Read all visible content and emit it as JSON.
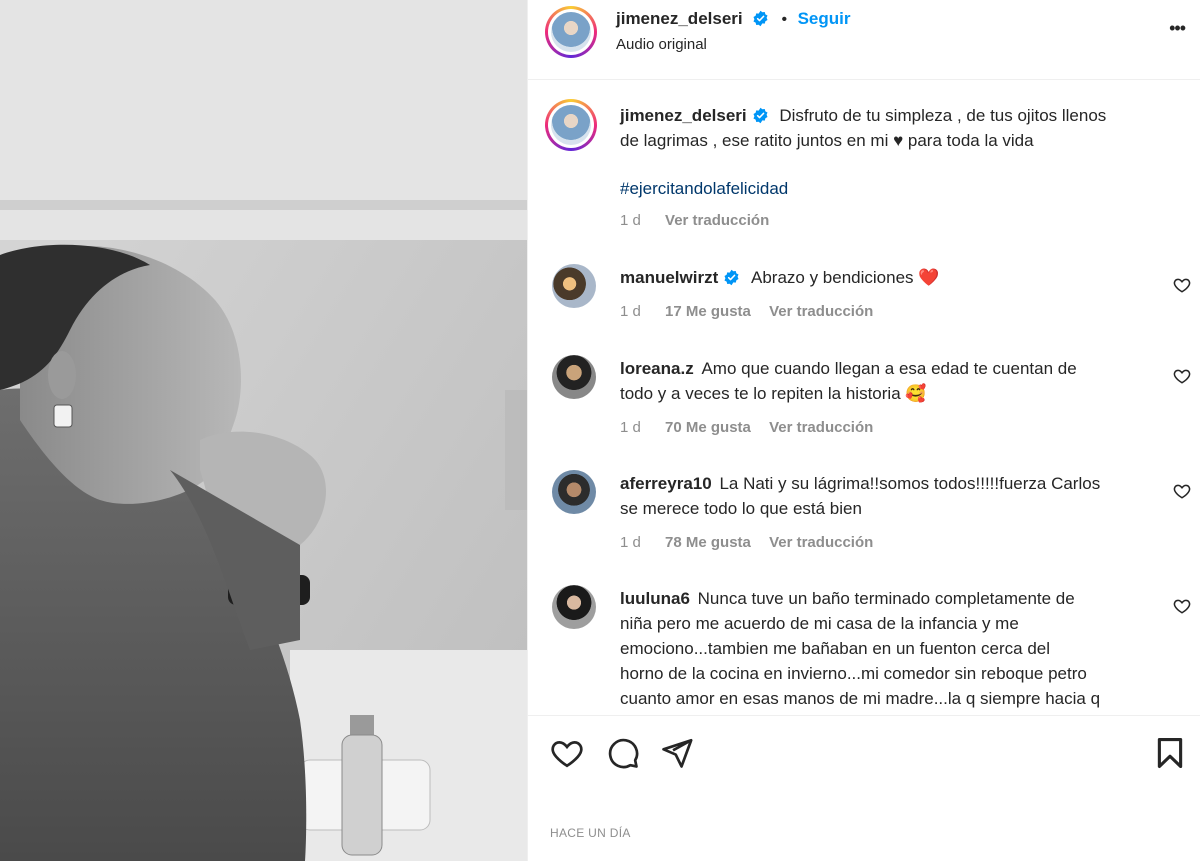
{
  "post": {
    "author": "jimenez_delseri",
    "audio": "Audio original",
    "follow_separator": "•",
    "follow_label": "Seguir",
    "more_label": "•••",
    "caption_line1": "Disfruto de tu simpleza , de tus ojitos llenos",
    "caption_line2": "de lagrimas , ese ratito juntos en mi ♥ para toda la vida",
    "hashtag": "#ejercitandolafelicidad",
    "caption_time": "1 d",
    "translate": "Ver traducción",
    "timestamp": "HACE UN DÍA"
  },
  "comments": [
    {
      "user": "manuelwirzt",
      "verified": true,
      "lines": [
        "Abrazo y bendiciones ❤️"
      ],
      "time": "1 d",
      "likes": "17 Me gusta",
      "translate": "Ver traducción"
    },
    {
      "user": "loreana.z",
      "verified": false,
      "lines": [
        "Amo que cuando llegan a esa edad te cuentan de",
        "todo y a veces te lo repiten la historia 🥰"
      ],
      "time": "1 d",
      "likes": "70 Me gusta",
      "translate": "Ver traducción"
    },
    {
      "user": "aferreyra10",
      "verified": false,
      "lines": [
        "La Nati y su lágrima!!somos todos!!!!!fuerza Carlos",
        "se merece todo lo que está bien"
      ],
      "time": "1 d",
      "likes": "78 Me gusta",
      "translate": "Ver traducción"
    },
    {
      "user": "luuluna6",
      "verified": false,
      "lines": [
        "Nunca tuve un baño terminado completamente de",
        "niña pero me acuerdo de mi casa de la infancia y me",
        "emociono...tambien me bañaban en un fuenton cerca del",
        "horno de la cocina en invierno...mi comedor sin reboque petro",
        "cuanto amor en esas manos de mi madre...la q siempre hacia q"
      ]
    }
  ],
  "icons": {
    "like": "heart-icon",
    "comment": "comment-icon",
    "share": "send-icon",
    "save": "bookmark-icon",
    "more": "more-icon",
    "verified": "verified-badge-icon"
  },
  "colors": {
    "link": "#0095f6",
    "hashtag": "#00376b",
    "secondary": "#8e8e8e",
    "verified": "#0095f6",
    "heart_red": "#ed4956"
  }
}
